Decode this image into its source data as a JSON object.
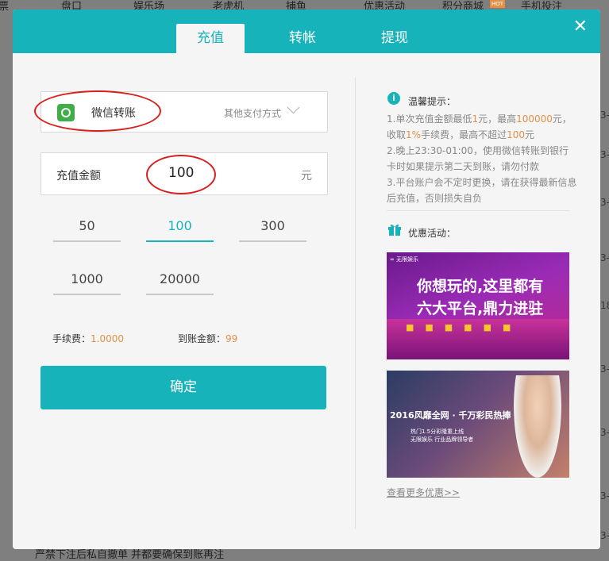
{
  "background": {
    "nav": [
      "票",
      "盘口",
      "娱乐场",
      "老虎机",
      "捕鱼",
      "优惠活动",
      "积分商城",
      "手机投注"
    ],
    "hot_badge": "HOT",
    "side_texts": [
      "3-",
      "3-",
      "3-",
      "3-",
      "18",
      "3-",
      "3-",
      "3-",
      "3-"
    ],
    "bottom_text": "严禁下注后私自撤单 并都要确保到账再注"
  },
  "tabs": [
    {
      "label": "充值",
      "active": true
    },
    {
      "label": "转帐",
      "active": false
    },
    {
      "label": "提现",
      "active": false
    }
  ],
  "close_symbol": "✕",
  "payment": {
    "method": "微信转账",
    "other": "其他支付方式"
  },
  "amount": {
    "label": "充值金额",
    "value": "100",
    "unit": "元"
  },
  "presets": [
    {
      "value": "50",
      "active": false
    },
    {
      "value": "100",
      "active": true
    },
    {
      "value": "300",
      "active": false
    },
    {
      "value": "1000",
      "active": false
    },
    {
      "value": "20000",
      "active": false
    }
  ],
  "fee": {
    "label": "手续费：",
    "value": "1.0000",
    "arrive_label": "到账金额：",
    "arrive_value": "99"
  },
  "confirm_label": "确定",
  "tips": {
    "title": "温馨提示：",
    "t1_a": "1.单次充值金额最低",
    "t1_b": "1",
    "t1_c": "元，最高",
    "t1_d": "100000",
    "t1_e": "元，",
    "t2_a": "收取",
    "t2_b": "1%",
    "t2_c": "手续费，最高不超过",
    "t2_d": "100",
    "t2_e": "元",
    "t3": "2.晚上23:30-01:00，使用微信转账到银行卡时如果提示第二天到账，请勿付款",
    "t4": "3.平台账户会不定时更换，请在获得最新信息后充值，否则损失自负"
  },
  "promos": {
    "title": "优惠活动：",
    "p1_tag": "∞ 无限娱乐",
    "p1_line1": "你想玩的,这里都有",
    "p1_line2": "六大平台,鼎力进驻",
    "p2_line1": "2016风靡全网 · 千万彩民热捧",
    "p2_line2": "热门1.5分彩隆重上线",
    "p2_line3": "无限娱乐 行业品牌领导者",
    "more": "查看更多优惠>>"
  },
  "colors": {
    "accent": "#17b3bb",
    "highlight": "#e39046",
    "annotation": "#d9201f"
  }
}
